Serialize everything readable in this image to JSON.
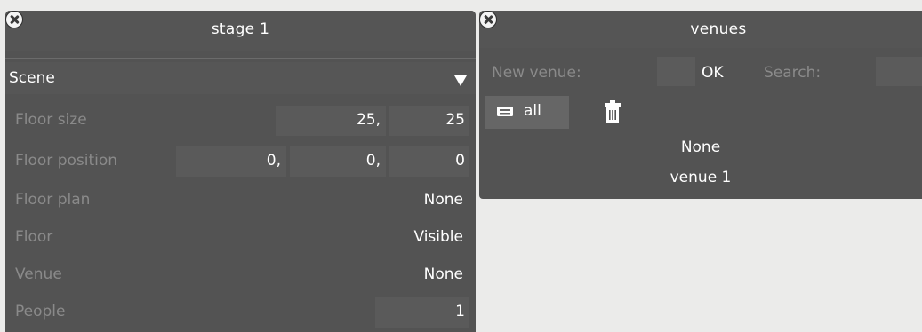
{
  "stage_panel": {
    "title": "stage 1",
    "section": "Scene",
    "rows": {
      "floor_size": {
        "label": "Floor size",
        "values": [
          "25,",
          "25"
        ]
      },
      "floor_position": {
        "label": "Floor position",
        "values": [
          "0,",
          "0,",
          "0"
        ]
      },
      "floor_plan": {
        "label": "Floor plan",
        "value": "None"
      },
      "floor": {
        "label": "Floor",
        "value": "Visible"
      },
      "venue": {
        "label": "Venue",
        "value": "None"
      },
      "people": {
        "label": "People",
        "value": "1"
      }
    }
  },
  "venues_panel": {
    "title": "venues",
    "new_venue_label": "New venue:",
    "new_venue_value": "",
    "ok_label": "OK",
    "search_label": "Search:",
    "search_value": "",
    "all_label": "all",
    "items": [
      "None",
      "venue 1"
    ]
  },
  "icons": [
    "close-icon",
    "dropdown-caret-icon",
    "device-icon",
    "trash-icon"
  ]
}
